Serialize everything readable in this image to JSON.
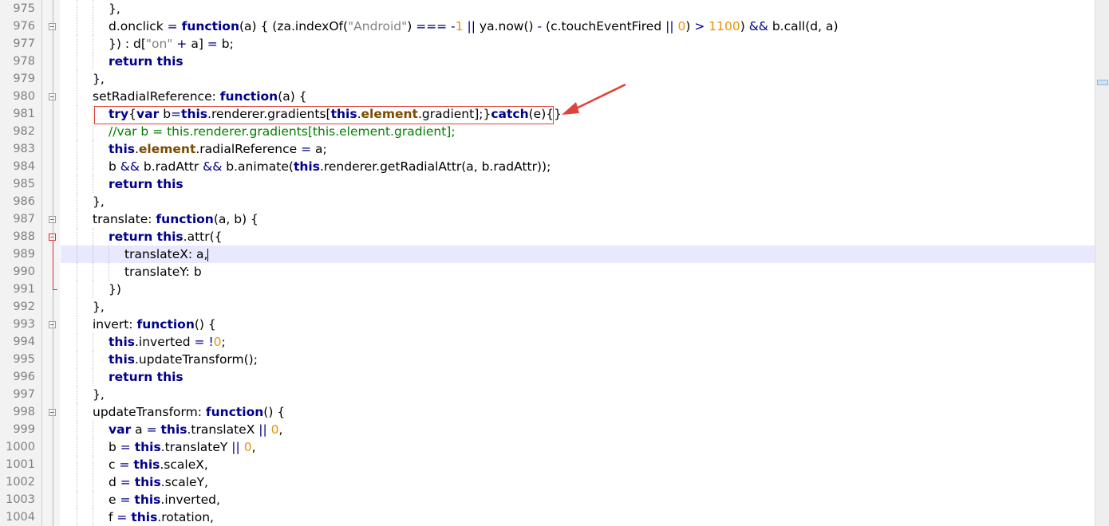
{
  "editor": {
    "active_line": "989",
    "lines": [
      {
        "n": "975",
        "fold": "none",
        "indent": 3,
        "tokens": [
          [
            "p",
            "},"
          ]
        ]
      },
      {
        "n": "976",
        "fold": "box",
        "indent": 3,
        "tokens": [
          [
            "p",
            "d.onclick "
          ],
          [
            "op",
            "="
          ],
          [
            "p",
            " "
          ],
          [
            "kw",
            "function"
          ],
          [
            "p",
            "(a) { (za.indexOf("
          ],
          [
            "str",
            "\"Android\""
          ],
          [
            "p",
            ") "
          ],
          [
            "op",
            "==="
          ],
          [
            "p",
            " "
          ],
          [
            "op",
            "-"
          ],
          [
            "num",
            "1"
          ],
          [
            "p",
            " "
          ],
          [
            "op",
            "||"
          ],
          [
            "p",
            " ya.now() "
          ],
          [
            "op",
            "-"
          ],
          [
            "p",
            " (c.touchEventFired "
          ],
          [
            "op",
            "||"
          ],
          [
            "p",
            " "
          ],
          [
            "num",
            "0"
          ],
          [
            "p",
            ") "
          ],
          [
            "op",
            ">"
          ],
          [
            "p",
            " "
          ],
          [
            "num",
            "1100"
          ],
          [
            "p",
            ") "
          ],
          [
            "op",
            "&&"
          ],
          [
            "p",
            " b.call(d, a)"
          ]
        ]
      },
      {
        "n": "977",
        "fold": "none",
        "indent": 3,
        "tokens": [
          [
            "p",
            "}) : d["
          ],
          [
            "str",
            "\"on\""
          ],
          [
            "p",
            " "
          ],
          [
            "op",
            "+"
          ],
          [
            "p",
            " a] "
          ],
          [
            "op",
            "="
          ],
          [
            "p",
            " b;"
          ]
        ]
      },
      {
        "n": "978",
        "fold": "none",
        "indent": 3,
        "tokens": [
          [
            "kw",
            "return this"
          ]
        ]
      },
      {
        "n": "979",
        "fold": "none",
        "indent": 2,
        "tokens": [
          [
            "p",
            "},"
          ]
        ]
      },
      {
        "n": "980",
        "fold": "box",
        "indent": 2,
        "tokens": [
          [
            "p",
            "setRadialReference: "
          ],
          [
            "kw",
            "function"
          ],
          [
            "p",
            "(a) {"
          ]
        ]
      },
      {
        "n": "981",
        "fold": "none",
        "indent": 3,
        "tokens": [
          [
            "kw",
            "try"
          ],
          [
            "p",
            "{"
          ],
          [
            "kw",
            "var"
          ],
          [
            "p",
            " b"
          ],
          [
            "op",
            "="
          ],
          [
            "kw",
            "this"
          ],
          [
            "p",
            ".renderer.gradients["
          ],
          [
            "kw",
            "this"
          ],
          [
            "p",
            "."
          ],
          [
            "el",
            "element"
          ],
          [
            "p",
            ".gradient];}"
          ],
          [
            "kw",
            "catch"
          ],
          [
            "p",
            "(e){}"
          ]
        ]
      },
      {
        "n": "982",
        "fold": "none",
        "indent": 3,
        "tokens": [
          [
            "com",
            "//var b = this.renderer.gradients[this.element.gradient];"
          ]
        ]
      },
      {
        "n": "983",
        "fold": "none",
        "indent": 3,
        "tokens": [
          [
            "kw",
            "this"
          ],
          [
            "p",
            "."
          ],
          [
            "el",
            "element"
          ],
          [
            "p",
            ".radialReference "
          ],
          [
            "op",
            "="
          ],
          [
            "p",
            " a;"
          ]
        ]
      },
      {
        "n": "984",
        "fold": "none",
        "indent": 3,
        "tokens": [
          [
            "p",
            "b "
          ],
          [
            "op",
            "&&"
          ],
          [
            "p",
            " b.radAttr "
          ],
          [
            "op",
            "&&"
          ],
          [
            "p",
            " b.animate("
          ],
          [
            "kw",
            "this"
          ],
          [
            "p",
            ".renderer.getRadialAttr(a, b.radAttr));"
          ]
        ]
      },
      {
        "n": "985",
        "fold": "none",
        "indent": 3,
        "tokens": [
          [
            "kw",
            "return this"
          ]
        ]
      },
      {
        "n": "986",
        "fold": "none",
        "indent": 2,
        "tokens": [
          [
            "p",
            "},"
          ]
        ]
      },
      {
        "n": "987",
        "fold": "box",
        "indent": 2,
        "tokens": [
          [
            "p",
            "translate: "
          ],
          [
            "kw",
            "function"
          ],
          [
            "p",
            "(a, b) {"
          ]
        ]
      },
      {
        "n": "988",
        "fold": "redbox",
        "indent": 3,
        "tokens": [
          [
            "kw",
            "return this"
          ],
          [
            "p",
            ".attr({"
          ]
        ]
      },
      {
        "n": "989",
        "fold": "none",
        "indent": 4,
        "tokens": [
          [
            "p",
            "translateX: a,"
          ]
        ],
        "caret": true
      },
      {
        "n": "990",
        "fold": "none",
        "indent": 4,
        "tokens": [
          [
            "p",
            "translateY: b"
          ]
        ]
      },
      {
        "n": "991",
        "fold": "none",
        "indent": 3,
        "tokens": [
          [
            "p",
            "})"
          ]
        ]
      },
      {
        "n": "992",
        "fold": "none",
        "indent": 2,
        "tokens": [
          [
            "p",
            "},"
          ]
        ]
      },
      {
        "n": "993",
        "fold": "box",
        "indent": 2,
        "tokens": [
          [
            "p",
            "invert: "
          ],
          [
            "kw",
            "function"
          ],
          [
            "p",
            "() {"
          ]
        ]
      },
      {
        "n": "994",
        "fold": "none",
        "indent": 3,
        "tokens": [
          [
            "kw",
            "this"
          ],
          [
            "p",
            ".inverted "
          ],
          [
            "op",
            "="
          ],
          [
            "p",
            " "
          ],
          [
            "op",
            "!"
          ],
          [
            "num",
            "0"
          ],
          [
            "p",
            ";"
          ]
        ]
      },
      {
        "n": "995",
        "fold": "none",
        "indent": 3,
        "tokens": [
          [
            "kw",
            "this"
          ],
          [
            "p",
            ".updateTransform();"
          ]
        ]
      },
      {
        "n": "996",
        "fold": "none",
        "indent": 3,
        "tokens": [
          [
            "kw",
            "return this"
          ]
        ]
      },
      {
        "n": "997",
        "fold": "none",
        "indent": 2,
        "tokens": [
          [
            "p",
            "},"
          ]
        ]
      },
      {
        "n": "998",
        "fold": "box",
        "indent": 2,
        "tokens": [
          [
            "p",
            "updateTransform: "
          ],
          [
            "kw",
            "function"
          ],
          [
            "p",
            "() {"
          ]
        ]
      },
      {
        "n": "999",
        "fold": "none",
        "indent": 3,
        "tokens": [
          [
            "kw",
            "var"
          ],
          [
            "p",
            " a "
          ],
          [
            "op",
            "="
          ],
          [
            "p",
            " "
          ],
          [
            "kw",
            "this"
          ],
          [
            "p",
            ".translateX "
          ],
          [
            "op",
            "||"
          ],
          [
            "p",
            " "
          ],
          [
            "num",
            "0"
          ],
          [
            "p",
            ","
          ]
        ]
      },
      {
        "n": "1000",
        "fold": "none",
        "indent": 3,
        "tokens": [
          [
            "p",
            "b "
          ],
          [
            "op",
            "="
          ],
          [
            "p",
            " "
          ],
          [
            "kw",
            "this"
          ],
          [
            "p",
            ".translateY "
          ],
          [
            "op",
            "||"
          ],
          [
            "p",
            " "
          ],
          [
            "num",
            "0"
          ],
          [
            "p",
            ","
          ]
        ]
      },
      {
        "n": "1001",
        "fold": "none",
        "indent": 3,
        "tokens": [
          [
            "p",
            "c "
          ],
          [
            "op",
            "="
          ],
          [
            "p",
            " "
          ],
          [
            "kw",
            "this"
          ],
          [
            "p",
            ".scaleX,"
          ]
        ]
      },
      {
        "n": "1002",
        "fold": "none",
        "indent": 3,
        "tokens": [
          [
            "p",
            "d "
          ],
          [
            "op",
            "="
          ],
          [
            "p",
            " "
          ],
          [
            "kw",
            "this"
          ],
          [
            "p",
            ".scaleY,"
          ]
        ]
      },
      {
        "n": "1003",
        "fold": "none",
        "indent": 3,
        "tokens": [
          [
            "p",
            "e "
          ],
          [
            "op",
            "="
          ],
          [
            "p",
            " "
          ],
          [
            "kw",
            "this"
          ],
          [
            "p",
            ".inverted,"
          ]
        ]
      },
      {
        "n": "1004",
        "fold": "none",
        "indent": 3,
        "tokens": [
          [
            "p",
            "f "
          ],
          [
            "op",
            "="
          ],
          [
            "p",
            " "
          ],
          [
            "kw",
            "this"
          ],
          [
            "p",
            ".rotation,"
          ]
        ]
      }
    ]
  },
  "colors": {
    "keyword": "#00008b",
    "element_property": "#7a4b00",
    "string": "#808080",
    "number": "#e8930c",
    "comment": "#008000",
    "annotation": "#e0413a",
    "current_line": "#e8e8ff"
  },
  "annotation": {
    "shape": "red-rectangle-with-arrow",
    "target_line": "981"
  }
}
